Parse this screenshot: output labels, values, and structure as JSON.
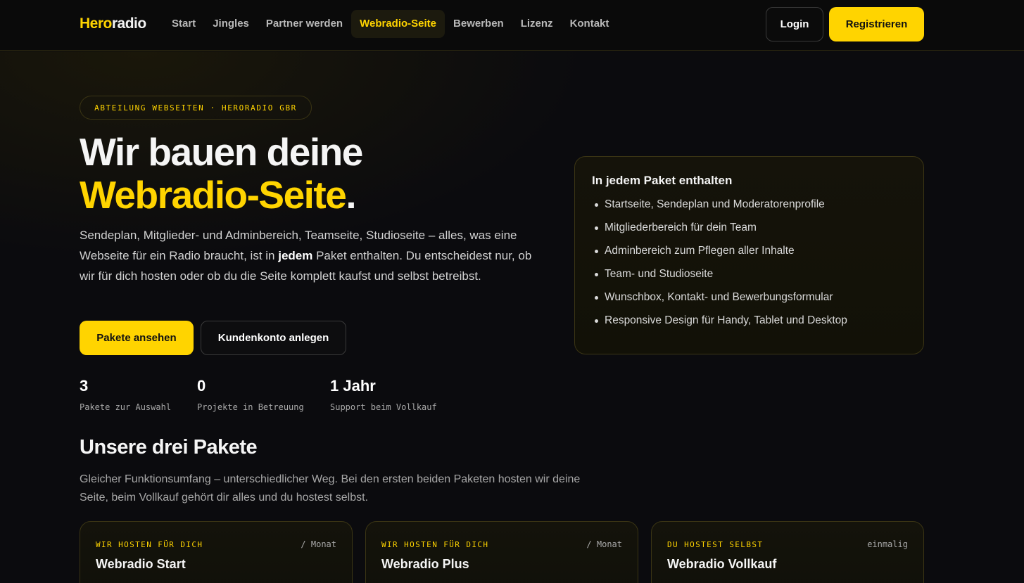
{
  "header": {
    "logo_part1": "Hero",
    "logo_part2": "radio",
    "nav": [
      {
        "label": "Start"
      },
      {
        "label": "Jingles"
      },
      {
        "label": "Partner werden"
      },
      {
        "label": "Webradio-Seite",
        "active": true
      },
      {
        "label": "Bewerben"
      },
      {
        "label": "Lizenz"
      },
      {
        "label": "Kontakt"
      }
    ],
    "login_label": "Login",
    "register_label": "Registrieren"
  },
  "hero": {
    "badge": "ABTEILUNG WEBSEITEN · HERORADIO GBR",
    "headline_line1": "Wir bauen deine",
    "headline_accent": "Webradio-Seite",
    "headline_dot": ".",
    "lead_part1": "Sendeplan, Mitglieder- und Adminbereich, Teamseite, Studioseite – alles, was eine Webseite für ein Radio braucht, ist in ",
    "lead_strong": "jedem",
    "lead_part2": " Paket enthalten. Du entscheidest nur, ob wir für dich hosten oder ob du die Seite komplett kaufst und selbst betreibst.",
    "primary_button": "Pakete ansehen",
    "secondary_button": "Kundenkonto anlegen",
    "stats": [
      {
        "value": "3",
        "label": "Pakete zur Auswahl"
      },
      {
        "value": "0",
        "label": "Projekte in Betreuung"
      },
      {
        "value": "1 Jahr",
        "label": "Support beim Vollkauf"
      }
    ]
  },
  "included": {
    "title": "In jedem Paket enthalten",
    "items": [
      "Startseite, Sendeplan und Moderatorenprofile",
      "Mitgliederbereich für dein Team",
      "Adminbereich zum Pflegen aller Inhalte",
      "Team- und Studioseite",
      "Wunschbox, Kontakt- und Bewerbungsformular",
      "Responsive Design für Handy, Tablet und Desktop"
    ]
  },
  "packages_section": {
    "title": "Unsere drei Pakete",
    "subtitle": "Gleicher Funktionsumfang – unterschiedlicher Weg. Bei den ersten beiden Paketen hosten wir deine Seite, beim Vollkauf gehört dir alles und du hostest selbst.",
    "packages": [
      {
        "tag": "WIR HOSTEN FÜR DICH",
        "period": "/ Monat",
        "name": "Webradio Start"
      },
      {
        "tag": "WIR HOSTEN FÜR DICH",
        "period": "/ Monat",
        "name": "Webradio Plus"
      },
      {
        "tag": "DU HOSTEST SELBST",
        "period": "einmalig",
        "name": "Webradio Vollkauf"
      }
    ]
  },
  "colors": {
    "accent": "#ffd400",
    "background": "#0b0b0e",
    "card_border": "#3b3514"
  }
}
